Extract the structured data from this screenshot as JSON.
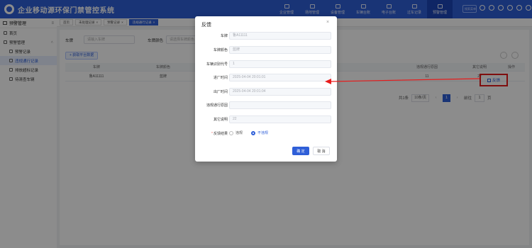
{
  "app": {
    "title": "企业移动源环保门禁管控系统"
  },
  "top_nav": [
    {
      "label": "企业管理",
      "active": false
    },
    {
      "label": "场地管理",
      "active": false
    },
    {
      "label": "设备管理",
      "active": false
    },
    {
      "label": "车辆台账",
      "active": false
    },
    {
      "label": "电子台账",
      "active": false
    },
    {
      "label": "过车记录",
      "active": false
    },
    {
      "label": "预警管理",
      "active": true
    }
  ],
  "top_search": {
    "placeholder": "搜索菜单"
  },
  "sidebar": {
    "header": "预警管理",
    "items": [
      {
        "label": "首页",
        "level": 1
      },
      {
        "label": "预警管理",
        "level": 1
      },
      {
        "label": "预警记录",
        "level": 2
      },
      {
        "label": "违规通行记录",
        "level": 2,
        "active": true
      },
      {
        "label": "排放超标记录",
        "level": 2
      },
      {
        "label": "待清查车辆",
        "level": 2
      }
    ]
  },
  "tabs": [
    {
      "label": "首页"
    },
    {
      "label": "未处理记录"
    },
    {
      "label": "预警记录"
    },
    {
      "label": "违规通行记录",
      "active": true
    }
  ],
  "filter": {
    "plate_label": "车牌",
    "plate_placeholder": "请输入车牌",
    "color_label": "车牌颜色",
    "color_placeholder": "请选择车牌颜色"
  },
  "toolbar": {
    "add_button": "+ 获取平台数据"
  },
  "table": {
    "columns": [
      "车牌",
      "车牌颜色",
      "违规通行原因",
      "其它说明",
      "操作"
    ],
    "rows": [
      {
        "plate": "鲁A11111",
        "color": "蓝牌",
        "reason": "11",
        "other": "22",
        "action": "反馈"
      }
    ]
  },
  "pagination": {
    "total": "共1条",
    "page_size": "10条/页",
    "prev": "‹",
    "current": "1",
    "next": "›",
    "goto_label": "前往",
    "goto_value": "1",
    "page_unit": "页"
  },
  "modal": {
    "title": "反馈",
    "close": "×",
    "fields": [
      {
        "label": "车牌",
        "value": "鲁A11111"
      },
      {
        "label": "车牌颜色",
        "value": "蓝牌"
      },
      {
        "label": "车辆识别代号",
        "value": "1"
      },
      {
        "label": "进厂时间",
        "value": "2025-04-04 20:01:01"
      },
      {
        "label": "出厂时间",
        "value": "2025-04-04 20:01:04"
      },
      {
        "label": "违规通行原因",
        "value": ""
      },
      {
        "label": "其它说明",
        "value": "22"
      }
    ],
    "result": {
      "label": "反馈结果",
      "required": "*",
      "options": [
        {
          "label": "违规",
          "checked": false
        },
        {
          "label": "不违规",
          "checked": true
        }
      ]
    },
    "ok": "确 定",
    "cancel": "取 消"
  },
  "colors": {
    "primary": "#2f5fd8",
    "annotation": "#e81b1b"
  }
}
